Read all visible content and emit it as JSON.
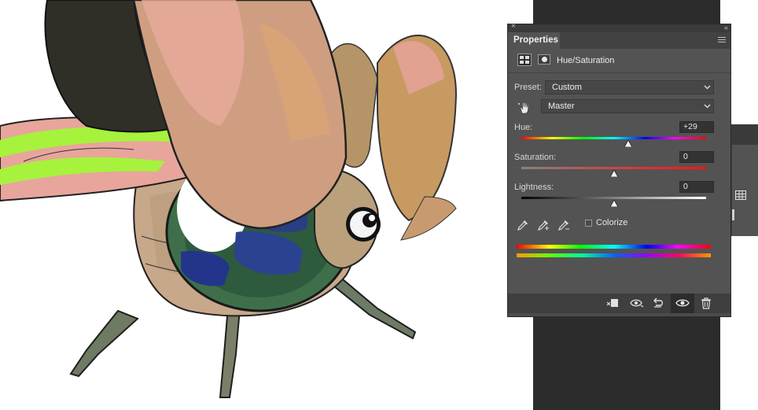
{
  "panel": {
    "tab_label": "Properties",
    "adjustment_title": "Hue/Saturation",
    "preset_label": "Preset:",
    "preset_value": "Custom",
    "channel_value": "Master",
    "hue": {
      "label": "Hue:",
      "value": "+29",
      "level": 0.58
    },
    "saturation": {
      "label": "Saturation:",
      "value": "0",
      "level": 0.5
    },
    "lightness": {
      "label": "Lightness:",
      "value": "0",
      "level": 0.5
    },
    "colorize_label": "Colorize",
    "colorize_checked": false
  },
  "icons": {
    "close": "close-icon",
    "collapse": "collapse-icon",
    "menu": "panel-menu-icon",
    "adjustment": "hue-saturation-adjustment-icon",
    "mask": "layer-mask-icon",
    "targeted_adjustment": "targeted-adjustment-hand-icon",
    "eyedroppers": [
      "eyedropper-icon",
      "eyedropper-add-icon",
      "eyedropper-subtract-icon"
    ],
    "bottom": [
      "clip-to-layer-icon",
      "view-previous-state-icon",
      "reset-icon",
      "visibility-eye-icon",
      "trash-icon"
    ]
  },
  "colors": {
    "panel_bg": "#535353",
    "workspace_dark": "#2c2c2c",
    "canvas_bg": "#ffffff"
  }
}
